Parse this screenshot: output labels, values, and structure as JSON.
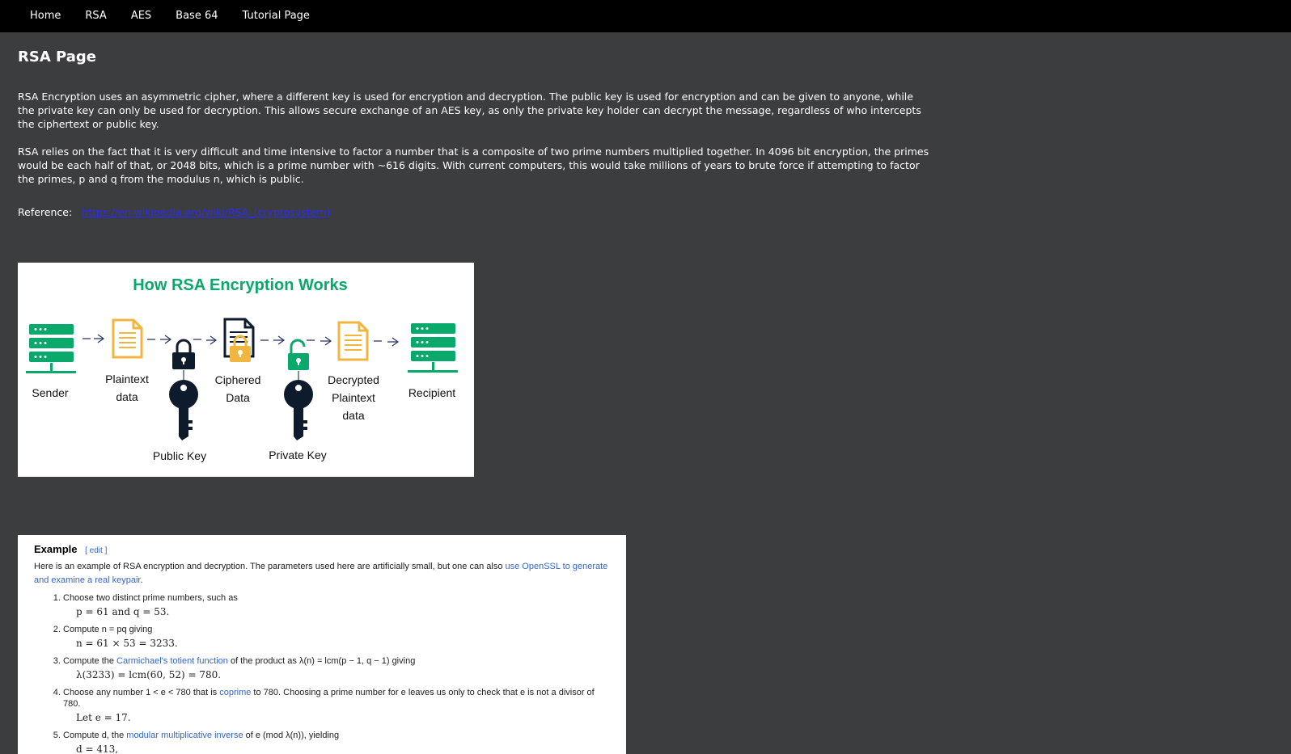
{
  "nav": {
    "items": [
      "Home",
      "RSA",
      "AES",
      "Base 64",
      "Tutorial Page"
    ]
  },
  "page": {
    "title": "RSA Page",
    "paragraph1": "RSA Encryption uses an asymmetric cipher, where a different key is used for encryption and decryption. The public key is used for encryption and can be given to anyone, while the private key can only be used for decryption. This allows secure exchange of an AES key, as only the private key holder can decrypt the message, regardless of who intercepts the ciphertext or public key.",
    "paragraph2": "RSA relies on the fact that it is very difficult and time intensive to factor a number that is a composite of two prime numbers multiplied together. In 4096 bit encryption, the primes would be each half of that, or 2048 bits, which is a prime number with ~616 digits. With current computers, this would take millions of years to brute force if attempting to factor the primes, p and q from the modulus n, which is public.",
    "reference_label": "Reference:",
    "reference_link": "https://en.wikipedia.org/wiki/RSA_(cryptosystem)"
  },
  "diagram": {
    "title": "How RSA Encryption Works",
    "labels": {
      "sender": "Sender",
      "plaintext1": "Plaintext",
      "plaintext2": "data",
      "ciphered1": "Ciphered",
      "ciphered2": "Data",
      "decrypted1": "Decrypted",
      "decrypted2": "Plaintext",
      "decrypted3": "data",
      "recipient": "Recipient",
      "public_key": "Public Key",
      "private_key": "Private Key"
    },
    "colors": {
      "green": "#0aa86b",
      "yellow": "#f0b640",
      "navy": "#0e1b2c",
      "arrow": "#2b3a67"
    }
  },
  "example": {
    "heading": "Example",
    "edit": "[ edit ]",
    "intro_text": "Here is an example of RSA encryption and decryption. The parameters used here are artificially small, but one can also ",
    "intro_link": "use OpenSSL to generate and examine a real keypair",
    "intro_end": ".",
    "steps": {
      "s1_text": "Choose two distinct prime numbers, such as",
      "s1_math": "p = 61 and q = 53.",
      "s2_text": "Compute n = pq giving",
      "s2_math": "n = 61 × 53 = 3233.",
      "s3_pre": "Compute the ",
      "s3_link": "Carmichael's totient function",
      "s3_post": " of the product as λ(n) = lcm(p − 1, q − 1) giving",
      "s3_math": "λ(3233) = lcm(60, 52) = 780.",
      "s4_pre": "Choose any number 1 < e < 780 that is ",
      "s4_link": "coprime",
      "s4_post": " to 780. Choosing a prime number for e leaves us only to check that e is not a divisor of 780.",
      "s4_math": "Let e = 17.",
      "s5_pre": "Compute d, the ",
      "s5_link": "modular multiplicative inverse",
      "s5_post": " of e (mod λ(n)), yielding",
      "s5_math": "d = 413,"
    }
  }
}
